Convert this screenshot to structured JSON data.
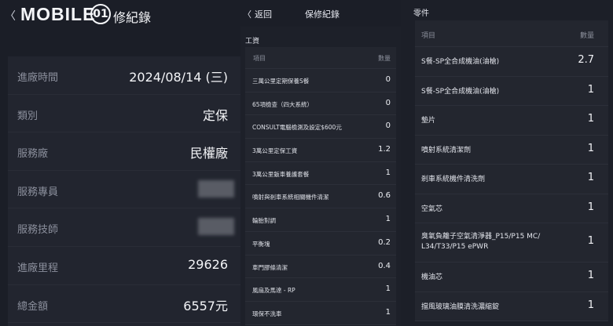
{
  "left_panel": {
    "back_label": "〈",
    "logo_text": "MOBILE",
    "logo_badge": "01",
    "title": "修紀錄",
    "rows": [
      {
        "label": "進廠時間",
        "value": "2024/08/14 (三)"
      },
      {
        "label": "類別",
        "value": "定保"
      },
      {
        "label": "服務廠",
        "value": "民權廠"
      },
      {
        "label": "服務專員",
        "value": ""
      },
      {
        "label": "服務技師",
        "value": ""
      },
      {
        "label": "進廠里程",
        "value": "29626"
      },
      {
        "label": "總金額",
        "value": "6557元"
      }
    ]
  },
  "middle_panel": {
    "back_label": "返回",
    "title": "保修紀錄",
    "section": "工資",
    "col_item": "項目",
    "col_qty": "數量",
    "rows": [
      {
        "item": "三萬公里定期保養S餐",
        "qty": "0"
      },
      {
        "item": "65項檢查（四大系統）",
        "qty": "0"
      },
      {
        "item": "CONSULT電腦檢測及設定$600元",
        "qty": "0"
      },
      {
        "item": "3萬公里定保工資",
        "qty": "1.2"
      },
      {
        "item": "3萬公里鈑車養護套餐",
        "qty": "1"
      },
      {
        "item": "噴射與剎車系統相關機件清潔",
        "qty": "0.6"
      },
      {
        "item": "輪胎對調",
        "qty": "1"
      },
      {
        "item": "平衡塊",
        "qty": "0.2"
      },
      {
        "item": "車門膠條清潔",
        "qty": "0.4"
      },
      {
        "item": "風扇及馬達 - RP",
        "qty": "1"
      },
      {
        "item": "環保不洗車",
        "qty": "1"
      }
    ]
  },
  "right_panel": {
    "section": "零件",
    "col_item": "項目",
    "col_qty": "數量",
    "rows": [
      {
        "item": "S餐-SP全合成機油(油槍)",
        "qty": "2.7"
      },
      {
        "item": "S餐-SP全合成機油(油槍)",
        "qty": "1"
      },
      {
        "item": "墊片",
        "qty": "1"
      },
      {
        "item": "噴射系統清潔劑",
        "qty": "1"
      },
      {
        "item": "剎車系統機件清洗劑",
        "qty": "1"
      },
      {
        "item": "空氣芯",
        "qty": "1"
      },
      {
        "item": "臭氧負離子空氣清淨器_P15/P15 MC/ L34/T33/P15 ePWR",
        "qty": "1"
      },
      {
        "item": "機油芯",
        "qty": "1"
      },
      {
        "item": "擋風玻璃油膜清洗濃縮錠",
        "qty": "1"
      }
    ]
  },
  "colors": {
    "background": "#1b1e27",
    "card": "#22252f",
    "label": "#8b8f9c",
    "text": "#f4f5f8"
  }
}
